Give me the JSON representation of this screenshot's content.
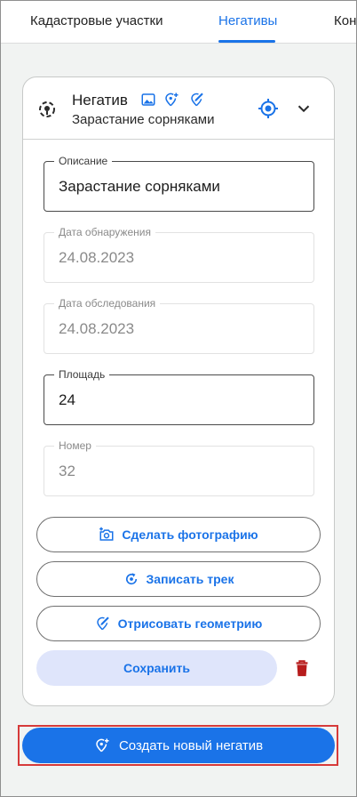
{
  "tabs": [
    {
      "label": "Кадастровые участки",
      "active": false
    },
    {
      "label": "Негативы",
      "active": true
    },
    {
      "label": "Конт",
      "active": false
    }
  ],
  "card": {
    "title": "Негатив",
    "subtitle": "Зарастание сорняками",
    "header_icons": [
      "polygon-pin-icon",
      "image-icon",
      "add-location-icon",
      "draw-icon",
      "my-location-icon",
      "chevron-down-icon"
    ]
  },
  "fields": {
    "description": {
      "label": "Описание",
      "value": "Зарастание сорняками"
    },
    "detection_date": {
      "label": "Дата обнаружения",
      "value": "24.08.2023"
    },
    "inspection_date": {
      "label": "Дата обследования",
      "value": "24.08.2023"
    },
    "area": {
      "label": "Площадь",
      "value": "24"
    },
    "number": {
      "label": "Номер",
      "value": "32"
    }
  },
  "actions": {
    "photo": "Сделать фотографию",
    "track": "Записать трек",
    "geometry": "Отрисовать геометрию",
    "save": "Сохранить"
  },
  "create_button": "Создать новый негатив",
  "colors": {
    "accent": "#1a73e8",
    "save_bg": "#dfe5fb",
    "delete": "#b71c1c",
    "highlight": "#d63a3a",
    "background": "#f1f3f2"
  }
}
